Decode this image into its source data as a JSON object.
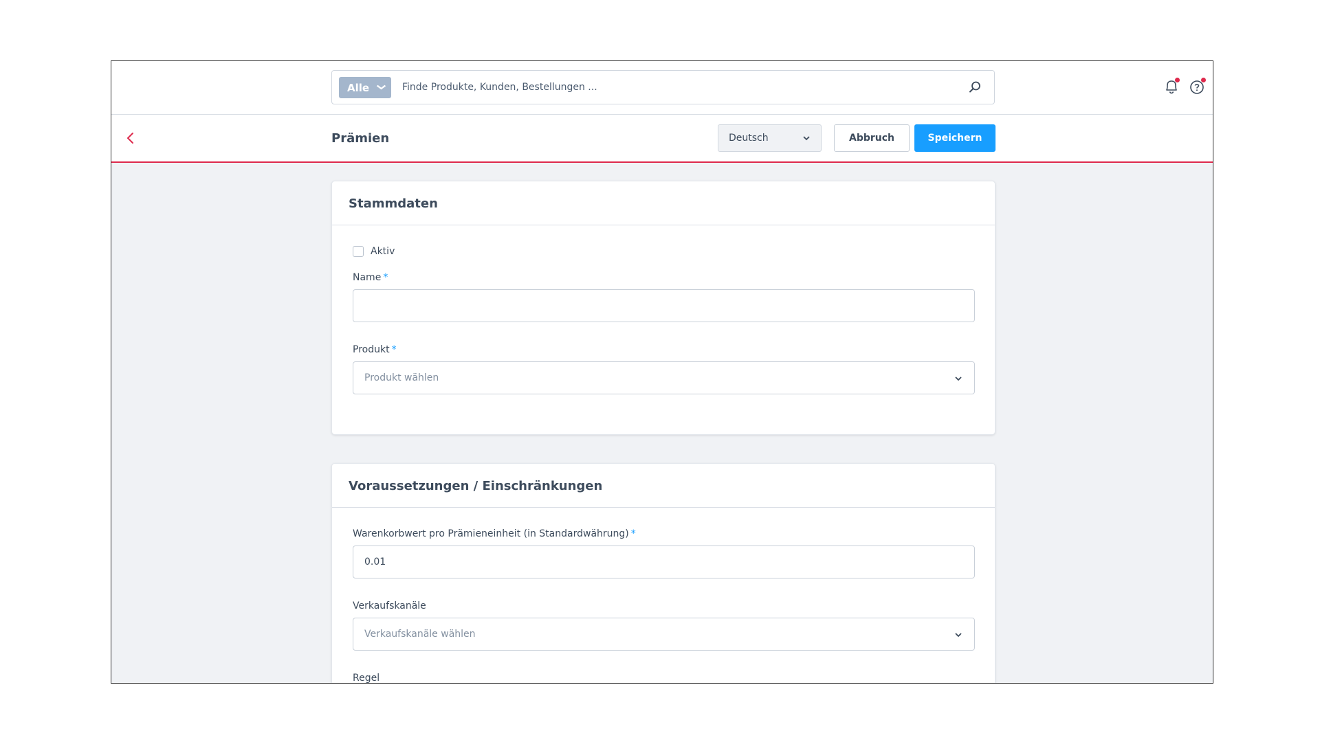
{
  "search": {
    "scope_label": "Alle",
    "placeholder": "Finde Produkte, Kunden, Bestellungen ..."
  },
  "header": {
    "title": "Prämien",
    "language": "Deutsch",
    "cancel_label": "Abbruch",
    "save_label": "Speichern"
  },
  "colors": {
    "accent": "#189eff",
    "header_border": "#de294c",
    "scope_bg": "#a4b6cc"
  },
  "card_master": {
    "title": "Stammdaten",
    "active_label": "Aktiv",
    "active_checked": false,
    "name_label": "Name",
    "name_value": "",
    "product_label": "Produkt",
    "product_placeholder": "Produkt wählen",
    "required_mark": "*"
  },
  "card_conditions": {
    "title": "Voraussetzungen / Einschränkungen",
    "cart_value_label": "Warenkorbwert pro Prämieneinheit (in Standardwährung)",
    "cart_value": "0.01",
    "channels_label": "Verkaufskanäle",
    "channels_placeholder": "Verkaufskanäle wählen",
    "rule_label": "Regel",
    "required_mark": "*"
  }
}
